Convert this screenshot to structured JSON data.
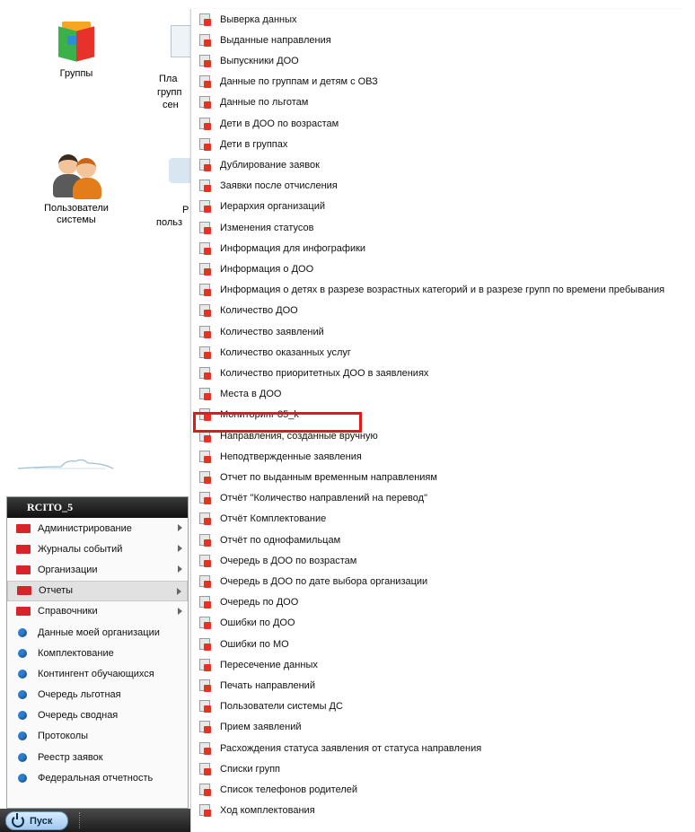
{
  "desktop": {
    "groups_label": "Группы",
    "users_label_1": "Пользователи",
    "users_label_2": "системы",
    "partial_1": "Пла",
    "partial_2": "групп",
    "partial_3": "сен",
    "partial_4": "Р",
    "partial_5": "польз"
  },
  "start_menu": {
    "title": "RCITO_5",
    "folders": [
      {
        "label": "Администрирование",
        "icon": "folder-icon"
      },
      {
        "label": "Журналы событий",
        "icon": "folder-icon"
      },
      {
        "label": "Организации",
        "icon": "folder-icon"
      },
      {
        "label": "Отчеты",
        "icon": "folder-icon"
      },
      {
        "label": "Справочники",
        "icon": "folder-icon"
      }
    ],
    "items": [
      "Данные моей организации",
      "Комплектование",
      "Контингент обучающихся",
      "Очередь льготная",
      "Очередь сводная",
      "Протоколы",
      "Реестр заявок",
      "Федеральная отчетность"
    ],
    "active": "Отчеты"
  },
  "taskbar": {
    "start_label": "Пуск"
  },
  "reports_submenu": {
    "items": [
      "Выверка данных",
      "Выданные направления",
      "Выпускники ДОО",
      "Данные по группам и детям с ОВЗ",
      "Данные по льготам",
      "Дети в ДОО по возрастам",
      "Дети в группах",
      "Дублирование заявок",
      "Заявки после отчисления",
      "Иерархия организаций",
      "Изменения статусов",
      "Информация для инфографики",
      "Информация о ДОО",
      "Информация о детях в разрезе возрастных категорий и в разрезе групп по времени пребывания",
      "Количество ДОО",
      "Количество заявлений",
      "Количество оказанных услуг",
      "Количество приоритетных ДОО в заявлениях",
      "Места в ДОО",
      "Мониторинг 85_k",
      "Направления, созданные вручную",
      "Неподтвержденные заявления",
      "Отчет по выданным временным направлениям",
      "Отчёт \"Количество направлений на перевод\"",
      "Отчёт Комплектование",
      "Отчёт по однофамильцам",
      "Очередь в ДОО по возрастам",
      "Очередь в ДОО по дате выбора организации",
      "Очередь по ДОО",
      "Ошибки по ДОО",
      "Ошибки по МО",
      "Пересечение данных",
      "Печать направлений",
      "Пользователи системы ДС",
      "Прием заявлений",
      "Расхождения статуса заявления от статуса направления",
      "Списки групп",
      "Список телефонов родителей",
      "Ход комплектования"
    ],
    "highlighted": "Мониторинг 85_k",
    "highlight_color": "#e31818"
  }
}
